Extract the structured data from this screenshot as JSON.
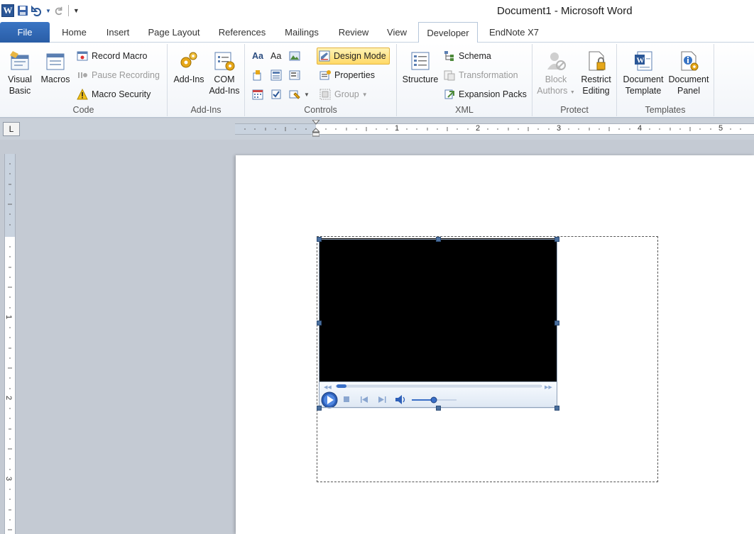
{
  "window": {
    "title": "Document1  -  Microsoft Word",
    "logo_letter": "W"
  },
  "qat": {
    "save": "save",
    "undo": "undo",
    "redo": "redo",
    "customize": "customize"
  },
  "tabs": [
    {
      "label": "File"
    },
    {
      "label": "Home"
    },
    {
      "label": "Insert"
    },
    {
      "label": "Page Layout"
    },
    {
      "label": "References"
    },
    {
      "label": "Mailings"
    },
    {
      "label": "Review"
    },
    {
      "label": "View"
    },
    {
      "label": "Developer"
    },
    {
      "label": "EndNote X7"
    }
  ],
  "active_tab": "Developer",
  "ribbon": {
    "code": {
      "label": "Code",
      "visual_basic_1": "Visual",
      "visual_basic_2": "Basic",
      "macros": "Macros",
      "record_macro": "Record Macro",
      "pause_recording": "Pause Recording",
      "macro_security": "Macro Security"
    },
    "addins": {
      "label": "Add-Ins",
      "add_ins": "Add-Ins",
      "com_1": "COM",
      "com_2": "Add-Ins"
    },
    "controls": {
      "label": "Controls",
      "aa_rich": "Aa",
      "aa_plain": "Aa",
      "design_mode": "Design Mode",
      "properties": "Properties",
      "group": "Group"
    },
    "xml": {
      "label": "XML",
      "structure": "Structure",
      "schema": "Schema",
      "transformation": "Transformation",
      "expansion_packs": "Expansion Packs"
    },
    "protect": {
      "label": "Protect",
      "block_1": "Block",
      "block_2": "Authors",
      "restrict_1": "Restrict",
      "restrict_2": "Editing"
    },
    "templates": {
      "label": "Templates",
      "doc_template_1": "Document",
      "doc_template_2": "Template",
      "doc_panel_1": "Document",
      "doc_panel_2": "Panel"
    }
  },
  "ruler": {
    "tab_selector": "L",
    "h_numbers": [
      "1",
      "2",
      "3",
      "4",
      "5"
    ],
    "v_numbers": [
      "1",
      "2",
      "3"
    ]
  },
  "colors": {
    "file_tab": "#2a5da6",
    "accent": "#2b5797",
    "design_mode_highlight": "#ffd966"
  }
}
